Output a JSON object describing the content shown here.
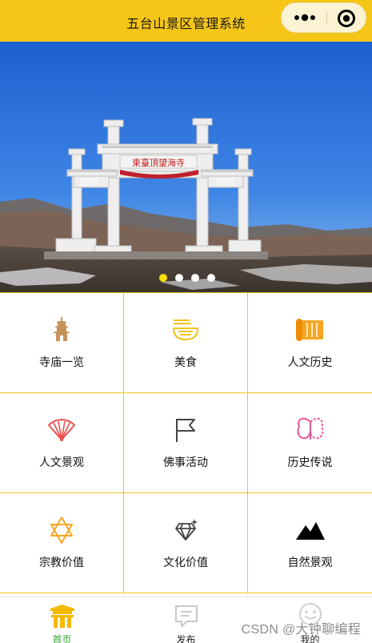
{
  "header": {
    "title": "五台山景区管理系统",
    "more_icon": "more-dots-icon",
    "close_icon": "record-close-icon",
    "color": "#f5c518"
  },
  "banner": {
    "plaque_text": "東臺頂望海寺",
    "slide_count": 4,
    "active_slide": 1
  },
  "grid": [
    {
      "label": "寺庙一览",
      "icon": "pagoda-icon"
    },
    {
      "label": "美食",
      "icon": "noodle-bowl-icon"
    },
    {
      "label": "人文历史",
      "icon": "scroll-icon"
    },
    {
      "label": "人文景观",
      "icon": "fan-icon"
    },
    {
      "label": "佛事活动",
      "icon": "flag-icon"
    },
    {
      "label": "历史传说",
      "icon": "butterfly-icon"
    },
    {
      "label": "宗教价值",
      "icon": "star-of-david-icon"
    },
    {
      "label": "文化价值",
      "icon": "diamond-icon"
    },
    {
      "label": "自然景观",
      "icon": "mountain-icon"
    }
  ],
  "tabbar": {
    "items": [
      {
        "label": "首页",
        "icon": "temple-gate-icon",
        "active": true
      },
      {
        "label": "发布",
        "icon": "chat-icon",
        "active": false
      },
      {
        "label": "我的",
        "icon": "smile-icon",
        "active": false
      }
    ],
    "active_color": "#2aa52a"
  },
  "watermark": "CSDN @大钟聊编程"
}
